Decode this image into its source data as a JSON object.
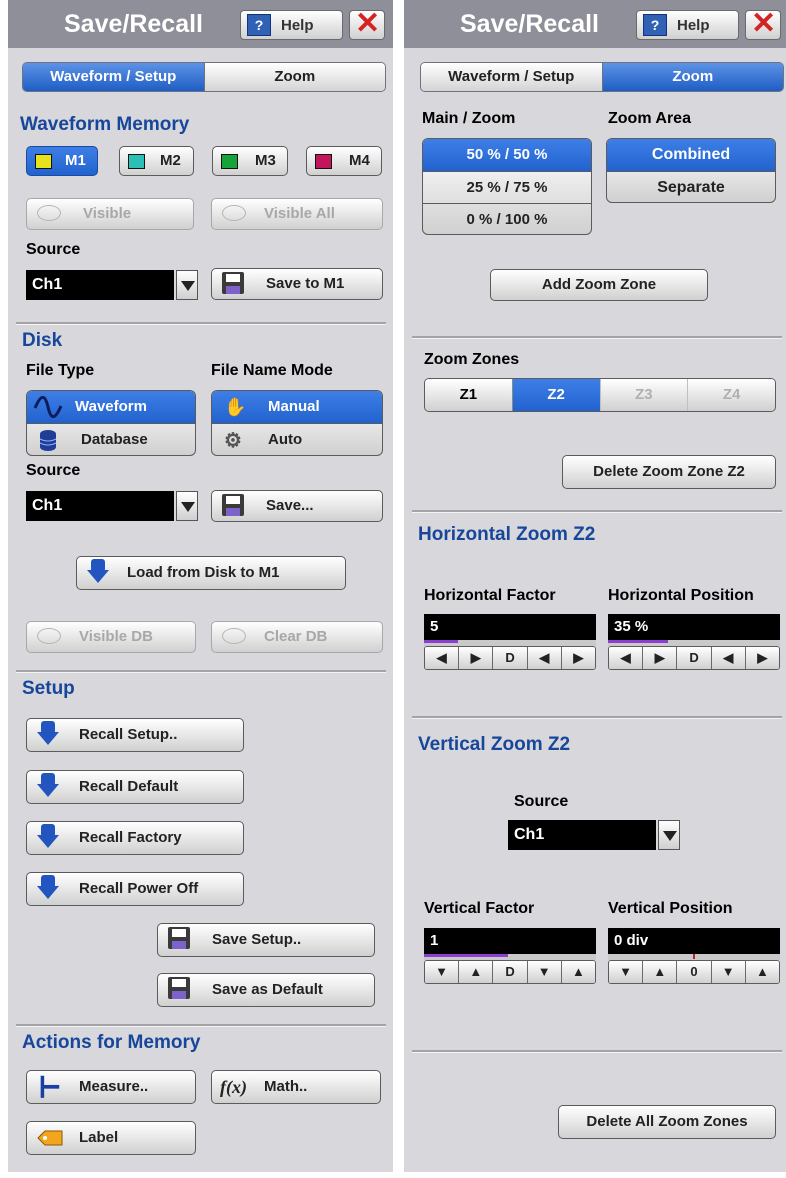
{
  "left": {
    "title": "Save/Recall",
    "help": "Help",
    "tabs": [
      "Waveform / Setup",
      "Zoom"
    ],
    "waveform_memory": {
      "heading": "Waveform Memory",
      "memories": [
        {
          "label": "M1",
          "color": "#e7e21e"
        },
        {
          "label": "M2",
          "color": "#2ac0b6"
        },
        {
          "label": "M3",
          "color": "#15a33a"
        },
        {
          "label": "M4",
          "color": "#c2165a"
        }
      ],
      "visible": "Visible",
      "visible_all": "Visible All",
      "source_label": "Source",
      "source_value": "Ch1",
      "save_to": "Save to M1"
    },
    "disk": {
      "heading": "Disk",
      "file_type_label": "File Type",
      "file_types": [
        "Waveform",
        "Database"
      ],
      "name_mode_label": "File Name Mode",
      "name_modes": [
        "Manual",
        "Auto"
      ],
      "source_label": "Source",
      "source_value": "Ch1",
      "save": "Save...",
      "load": "Load from Disk to M1",
      "visible_db": "Visible DB",
      "clear_db": "Clear DB"
    },
    "setup": {
      "heading": "Setup",
      "recall_setup": "Recall Setup..",
      "recall_default": "Recall Default",
      "recall_factory": "Recall Factory",
      "recall_power_off": "Recall Power Off",
      "save_setup": "Save Setup..",
      "save_default": "Save as Default"
    },
    "actions": {
      "heading": "Actions for Memory",
      "measure": "Measure..",
      "math": "Math..",
      "label": "Label"
    }
  },
  "right": {
    "title": "Save/Recall",
    "help": "Help",
    "tabs": [
      "Waveform / Setup",
      "Zoom"
    ],
    "main_zoom_label": "Main / Zoom",
    "main_zoom_options": [
      "50 % / 50 %",
      "25 % / 75 %",
      "0 % / 100 %"
    ],
    "zoom_area_label": "Zoom Area",
    "zoom_area_options": [
      "Combined",
      "Separate"
    ],
    "add_zone": "Add Zoom Zone",
    "zones_label": "Zoom Zones",
    "zones": [
      "Z1",
      "Z2",
      "Z3",
      "Z4"
    ],
    "delete_zone": "Delete Zoom Zone Z2",
    "horizontal_heading": "Horizontal Zoom Z2",
    "h_factor_label": "Horizontal Factor",
    "h_factor_value": "5",
    "h_position_label": "Horizontal Position",
    "h_position_value": "35 %",
    "vertical_heading": "Vertical Zoom Z2",
    "v_source_label": "Source",
    "v_source_value": "Ch1",
    "v_factor_label": "Vertical Factor",
    "v_factor_value": "1",
    "v_position_label": "Vertical Position",
    "v_position_value": "0 div",
    "h_controls": [
      "◀",
      "▶",
      "D",
      "◀",
      "▶"
    ],
    "v_controls": [
      "▼",
      "▲",
      "D",
      "▼",
      "▲"
    ],
    "vpos_controls": [
      "▼",
      "▲",
      "0",
      "▼",
      "▲"
    ],
    "delete_all": "Delete All Zoom Zones"
  }
}
